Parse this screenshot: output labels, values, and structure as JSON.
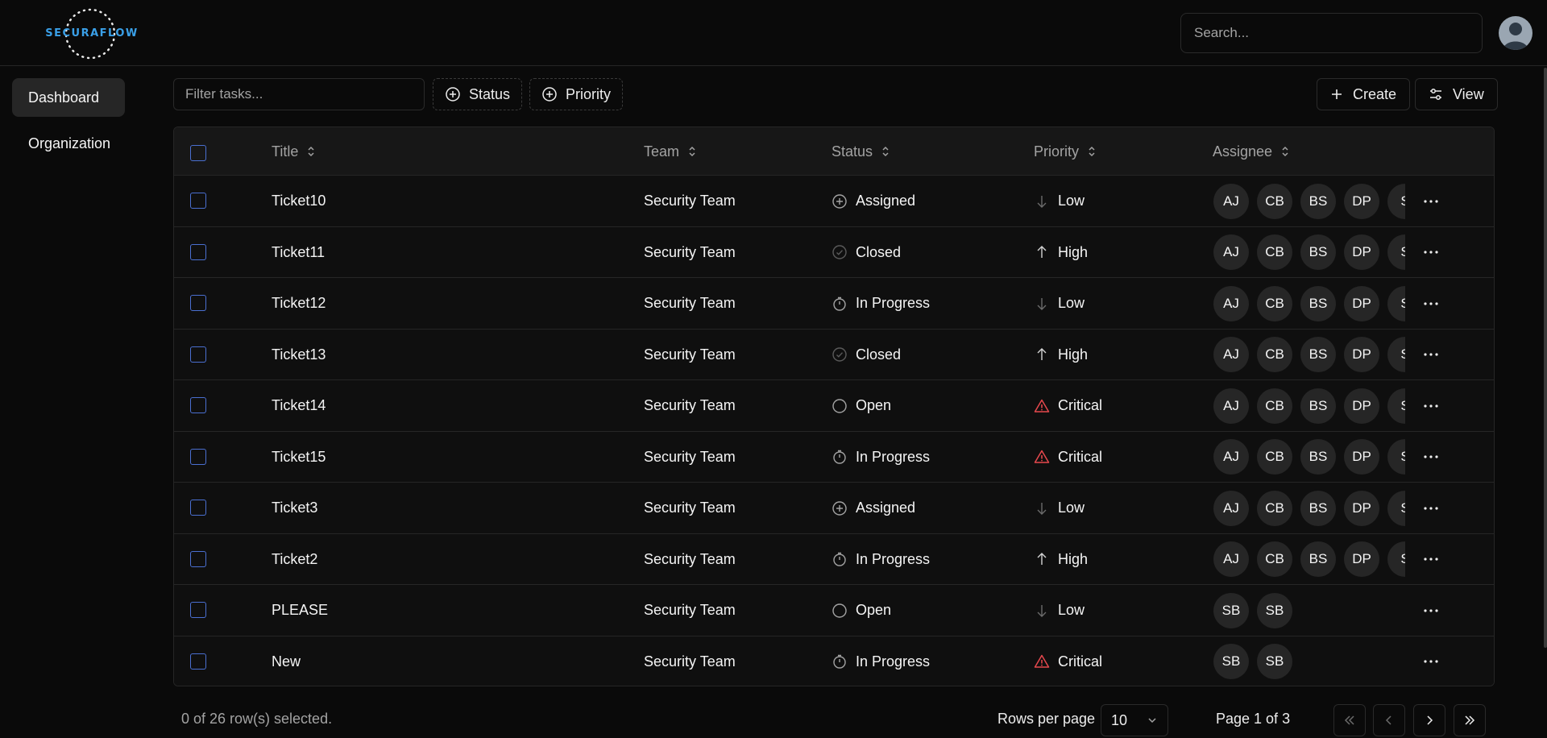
{
  "header": {
    "logo_text": "SECURAFLOW",
    "search_placeholder": "Search..."
  },
  "sidebar": {
    "items": [
      {
        "label": "Dashboard",
        "active": true
      },
      {
        "label": "Organization",
        "active": false
      }
    ]
  },
  "toolbar": {
    "filter_placeholder": "Filter tasks...",
    "status_filter_label": "Status",
    "priority_filter_label": "Priority",
    "create_label": "Create",
    "view_label": "View"
  },
  "table": {
    "columns": [
      "Title",
      "Team",
      "Status",
      "Priority",
      "Assignee"
    ],
    "rows": [
      {
        "title": "Ticket10",
        "team": "Security Team",
        "status": "Assigned",
        "status_icon": "circle-plus-icon",
        "priority": "Low",
        "priority_icon": "arrow-down-icon",
        "assignees": [
          "AJ",
          "CB",
          "BS",
          "DP",
          "S"
        ]
      },
      {
        "title": "Ticket11",
        "team": "Security Team",
        "status": "Closed",
        "status_icon": "check-circle-icon",
        "priority": "High",
        "priority_icon": "arrow-up-icon",
        "assignees": [
          "AJ",
          "CB",
          "BS",
          "DP",
          "S"
        ]
      },
      {
        "title": "Ticket12",
        "team": "Security Team",
        "status": "In Progress",
        "status_icon": "timer-icon",
        "priority": "Low",
        "priority_icon": "arrow-down-icon",
        "assignees": [
          "AJ",
          "CB",
          "BS",
          "DP",
          "S"
        ]
      },
      {
        "title": "Ticket13",
        "team": "Security Team",
        "status": "Closed",
        "status_icon": "check-circle-icon",
        "priority": "High",
        "priority_icon": "arrow-up-icon",
        "assignees": [
          "AJ",
          "CB",
          "BS",
          "DP",
          "S"
        ]
      },
      {
        "title": "Ticket14",
        "team": "Security Team",
        "status": "Open",
        "status_icon": "circle-icon",
        "priority": "Critical",
        "priority_icon": "warning-icon",
        "assignees": [
          "AJ",
          "CB",
          "BS",
          "DP",
          "S"
        ]
      },
      {
        "title": "Ticket15",
        "team": "Security Team",
        "status": "In Progress",
        "status_icon": "timer-icon",
        "priority": "Critical",
        "priority_icon": "warning-icon",
        "assignees": [
          "AJ",
          "CB",
          "BS",
          "DP",
          "S"
        ]
      },
      {
        "title": "Ticket3",
        "team": "Security Team",
        "status": "Assigned",
        "status_icon": "circle-plus-icon",
        "priority": "Low",
        "priority_icon": "arrow-down-icon",
        "assignees": [
          "AJ",
          "CB",
          "BS",
          "DP",
          "S"
        ]
      },
      {
        "title": "Ticket2",
        "team": "Security Team",
        "status": "In Progress",
        "status_icon": "timer-icon",
        "priority": "High",
        "priority_icon": "arrow-up-icon",
        "assignees": [
          "AJ",
          "CB",
          "BS",
          "DP",
          "S"
        ]
      },
      {
        "title": "PLEASE",
        "team": "Security Team",
        "status": "Open",
        "status_icon": "circle-icon",
        "priority": "Low",
        "priority_icon": "arrow-down-icon",
        "assignees": [
          "SB",
          "SB"
        ]
      },
      {
        "title": "New",
        "team": "Security Team",
        "status": "In Progress",
        "status_icon": "timer-icon",
        "priority": "Critical",
        "priority_icon": "warning-icon",
        "assignees": [
          "SB",
          "SB"
        ]
      }
    ]
  },
  "footer": {
    "selection_text": "0 of 26 row(s) selected.",
    "rows_per_page_label": "Rows per page",
    "rows_per_page_value": "10",
    "page_text": "Page 1 of 3"
  },
  "colors": {
    "background": "#0a0a0a",
    "accent_checkbox": "#4a6fd0",
    "critical": "#e5484d",
    "logo": "#3aa0e8"
  }
}
